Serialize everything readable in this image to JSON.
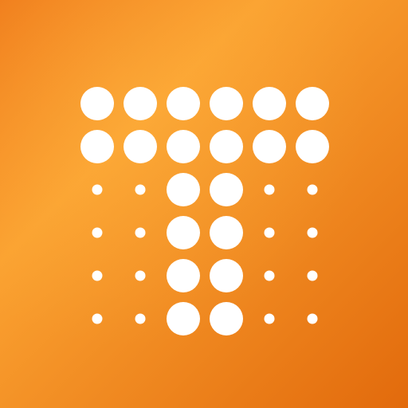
{
  "icon": {
    "name": "dotted-letter-t-logo",
    "background": {
      "gradient_start": "#F07A1A",
      "gradient_mid": "#FBA231",
      "gradient_end": "#E26A0C"
    },
    "dot_color": "#FFFFFF",
    "grid": {
      "rows": [
        [
          "L",
          "L",
          "L",
          "L",
          "L",
          "L"
        ],
        [
          "L",
          "L",
          "L",
          "L",
          "L",
          "L"
        ],
        [
          "S",
          "S",
          "L",
          "L",
          "S",
          "S"
        ],
        [
          "S",
          "S",
          "L",
          "L",
          "S",
          "S"
        ],
        [
          "S",
          "S",
          "L",
          "L",
          "S",
          "S"
        ],
        [
          "S",
          "S",
          "L",
          "L",
          "S",
          "S"
        ]
      ]
    }
  }
}
